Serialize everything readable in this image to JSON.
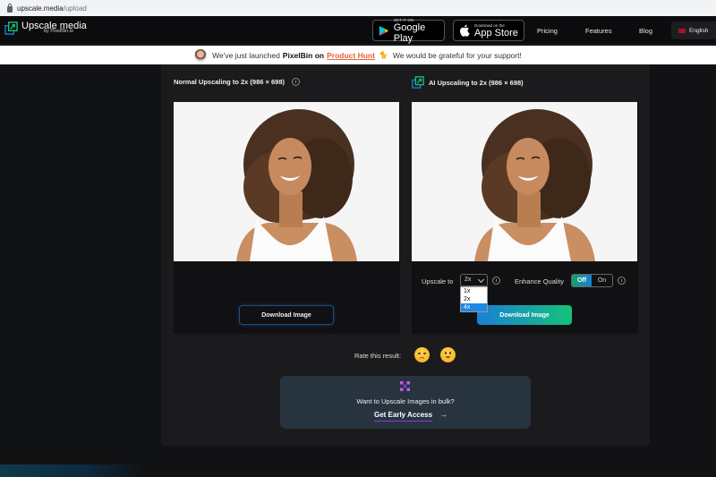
{
  "browser": {
    "url_domain": "upscale.media",
    "url_path": "/upload"
  },
  "nav": {
    "logo_title": "Upscale media",
    "logo_subtitle": "by PixelBin.io",
    "google_play_small": "GET IT ON",
    "google_play_big": "Google Play",
    "app_store_small": "Download on the",
    "app_store_big": "App Store",
    "links": [
      "Pricing",
      "Features",
      "Blog"
    ],
    "language": "English"
  },
  "banner": {
    "text_before": "We've just launched",
    "brand": "PixelBin on",
    "product_hunt": "Product Hunt",
    "text_after": "We would be grateful for your support!"
  },
  "left_panel": {
    "title": "Normal Upscaling to 2x (986 × 698)",
    "download_label": "Download Image"
  },
  "right_panel": {
    "title": "AI Upscaling to 2x (986 × 698)",
    "upscale_label": "Upscale to",
    "upscale_value": "2x",
    "upscale_options": [
      "1x",
      "2x",
      "4x"
    ],
    "upscale_highlighted": "4x",
    "enhance_label": "Enhance Quality",
    "toggle_off": "Off",
    "toggle_on": "On",
    "enhance_state": "Off",
    "download_label": "Download Image"
  },
  "rating": {
    "label": "Rate this result:",
    "options": [
      "sad",
      "happy"
    ]
  },
  "bulk": {
    "text": "Want to Upscale Images in bulk?",
    "link": "Get Early Access",
    "arrow": "→"
  },
  "colors": {
    "accent_green": "#14c27a",
    "accent_blue": "#1a7fd6",
    "product_hunt": "#e8613c",
    "bulk_card": "#283340",
    "link_underline": "#8b3cd6"
  }
}
